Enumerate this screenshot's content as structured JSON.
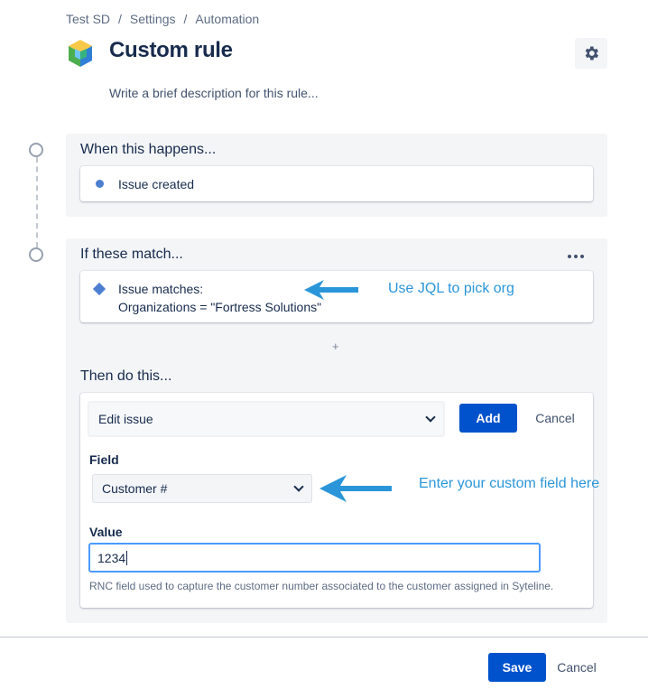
{
  "breadcrumb": [
    "Test SD",
    "Settings",
    "Automation"
  ],
  "header": {
    "title": "Custom rule",
    "description_placeholder": "Write a brief description for this rule..."
  },
  "trigger": {
    "heading": "When this happens...",
    "item": "Issue created"
  },
  "condition": {
    "heading": "If these match...",
    "line1": "Issue matches:",
    "line2": "Organizations = \"Fortress Solutions\"",
    "add_symbol": "+"
  },
  "action": {
    "heading": "Then do this...",
    "selected_action": "Edit issue",
    "add_label": "Add",
    "cancel_label": "Cancel",
    "field_label": "Field",
    "field_value": "Customer #",
    "value_label": "Value",
    "value": "1234",
    "help": "RNC field used to capture the customer number associated to the customer assigned in Syteline."
  },
  "annotations": {
    "jql": "Use JQL to pick org",
    "custom_field": "Enter your custom field here"
  },
  "footer": {
    "save_label": "Save",
    "cancel_label": "Cancel"
  },
  "colors": {
    "primary": "#0052cc",
    "annotation": "#2a96d9",
    "panel_bg": "#f4f5f7",
    "focus_border": "#4c9aff"
  },
  "icons": [
    "app-logo-icon",
    "gear-icon",
    "chevron-down-icon",
    "more-icon",
    "arrow-left-icon"
  ]
}
